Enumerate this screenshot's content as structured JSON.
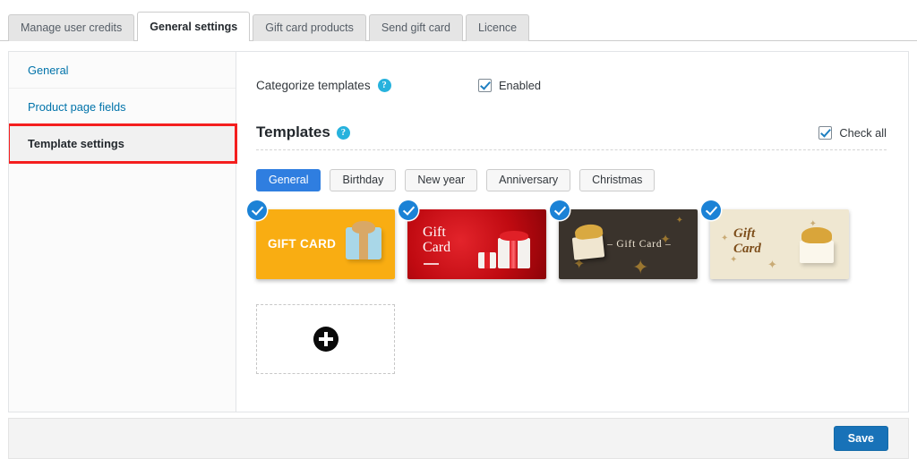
{
  "tabs": [
    {
      "label": "Manage user credits",
      "active": false
    },
    {
      "label": "General settings",
      "active": true
    },
    {
      "label": "Gift card products",
      "active": false
    },
    {
      "label": "Send gift card",
      "active": false
    },
    {
      "label": "Licence",
      "active": false
    }
  ],
  "sidebar": {
    "items": [
      {
        "label": "General",
        "active": false
      },
      {
        "label": "Product page fields",
        "active": false
      },
      {
        "label": "Template settings",
        "active": true
      }
    ]
  },
  "settings": {
    "categorize": {
      "label": "Categorize templates",
      "help_icon": "help-circle-icon",
      "help_glyph": "?",
      "checkbox_label": "Enabled",
      "checked": true
    }
  },
  "templates_section": {
    "title": "Templates",
    "help_icon": "help-circle-icon",
    "help_glyph": "?",
    "check_all_label": "Check all",
    "check_all_checked": true,
    "categories": [
      {
        "label": "General",
        "active": true
      },
      {
        "label": "Birthday",
        "active": false
      },
      {
        "label": "New year",
        "active": false
      },
      {
        "label": "Anniversary",
        "active": false
      },
      {
        "label": "Christmas",
        "active": false
      }
    ],
    "cards": [
      {
        "id": "orange-gift-card",
        "text": "GIFT CARD",
        "selected": true,
        "bg": "#f9ad12"
      },
      {
        "id": "red-gift-card",
        "text_line1": "Gift",
        "text_line2": "Card",
        "selected": true,
        "bg": "#c00a11"
      },
      {
        "id": "dark-gift-card",
        "text": "– Gift Card –",
        "selected": true,
        "bg": "#3a332c"
      },
      {
        "id": "cream-gift-card",
        "text_line1": "Gift",
        "text_line2": "Card",
        "selected": true,
        "bg": "#efe7d1"
      }
    ],
    "add_card": {
      "icon": "plus-circle-icon",
      "label": ""
    }
  },
  "footer": {
    "save_label": "Save"
  },
  "colors": {
    "accent_blue": "#1872b8",
    "active_category": "#2f7ee0",
    "check_badge": "#1b82d6",
    "help_icon": "#27b2dd",
    "highlight_border": "#f41e1e",
    "link": "#0073aa"
  }
}
